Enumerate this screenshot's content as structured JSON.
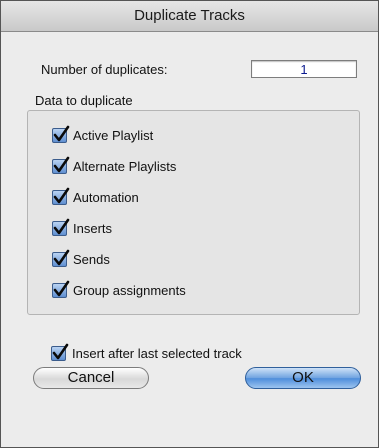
{
  "window": {
    "title": "Duplicate Tracks"
  },
  "number_of_duplicates": {
    "label": "Number of duplicates:",
    "value": "1"
  },
  "data_group": {
    "label": "Data to duplicate",
    "items": [
      {
        "label": "Active Playlist",
        "checked": true
      },
      {
        "label": "Alternate Playlists",
        "checked": true
      },
      {
        "label": "Automation",
        "checked": true
      },
      {
        "label": "Inserts",
        "checked": true
      },
      {
        "label": "Sends",
        "checked": true
      },
      {
        "label": "Group assignments",
        "checked": true
      }
    ]
  },
  "insert_after": {
    "label": "Insert after last selected track",
    "checked": true
  },
  "buttons": {
    "cancel_label": "Cancel",
    "ok_label": "OK"
  },
  "colors": {
    "checkbox_fill": "#5f8fd1",
    "checkmark": "#0a0a0a",
    "ok_button": "#4d8ddb"
  }
}
